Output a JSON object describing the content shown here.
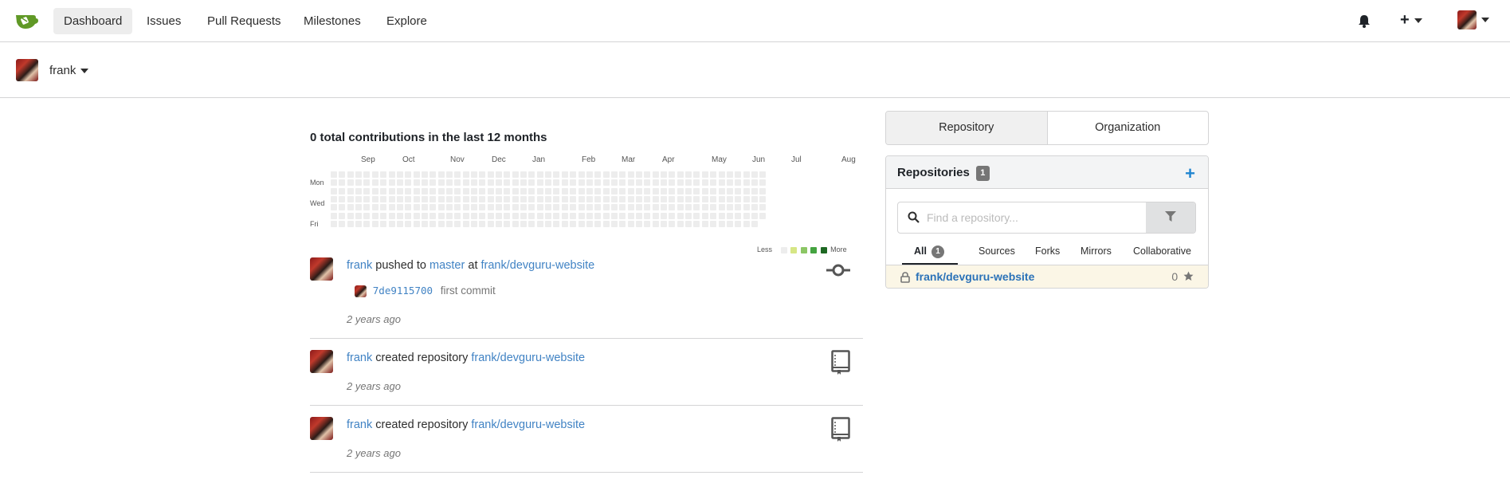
{
  "nav": {
    "items": [
      {
        "label": "Dashboard",
        "active": true
      },
      {
        "label": "Issues"
      },
      {
        "label": "Pull Requests"
      },
      {
        "label": "Milestones"
      },
      {
        "label": "Explore"
      }
    ],
    "icons": [
      "bell-icon",
      "plus-icon",
      "avatar"
    ]
  },
  "userbar": {
    "name": "frank"
  },
  "contributions": {
    "title": "0 total contributions in the last 12 months",
    "months": [
      "Sep",
      "Oct",
      "Nov",
      "Dec",
      "Jan",
      "Feb",
      "Mar",
      "Apr",
      "May",
      "Jun",
      "Jul",
      "Aug"
    ],
    "days": [
      "Mon",
      "Wed",
      "Fri"
    ],
    "legend_less": "Less",
    "legend_more": "More",
    "legend_colors": [
      "#ededed",
      "#d6e685",
      "#8cc665",
      "#44a340",
      "#1e6823"
    ]
  },
  "feed": [
    {
      "user": "frank",
      "action": "pushed to",
      "branch": "master",
      "at": "at",
      "repo": "frank/devguru-website",
      "commit_sha": "7de9115700",
      "commit_msg": "first commit",
      "time": "2 years ago",
      "icon": "commit-icon"
    },
    {
      "user": "frank",
      "action": "created repository",
      "repo": "frank/devguru-website",
      "time": "2 years ago",
      "icon": "repo-book-icon"
    },
    {
      "user": "frank",
      "action": "created repository",
      "repo": "frank/devguru-website",
      "time": "2 years ago",
      "icon": "repo-book-icon"
    }
  ],
  "sidebar": {
    "switch": {
      "repository": "Repository",
      "organization": "Organization"
    },
    "repos_title": "Repositories",
    "repos_count": "1",
    "search_placeholder": "Find a repository...",
    "tabs": {
      "all": "All",
      "all_count": "1",
      "sources": "Sources",
      "forks": "Forks",
      "mirrors": "Mirrors",
      "collaborative": "Collaborative"
    },
    "repo": {
      "name": "frank/devguru-website",
      "stars": "0"
    }
  }
}
